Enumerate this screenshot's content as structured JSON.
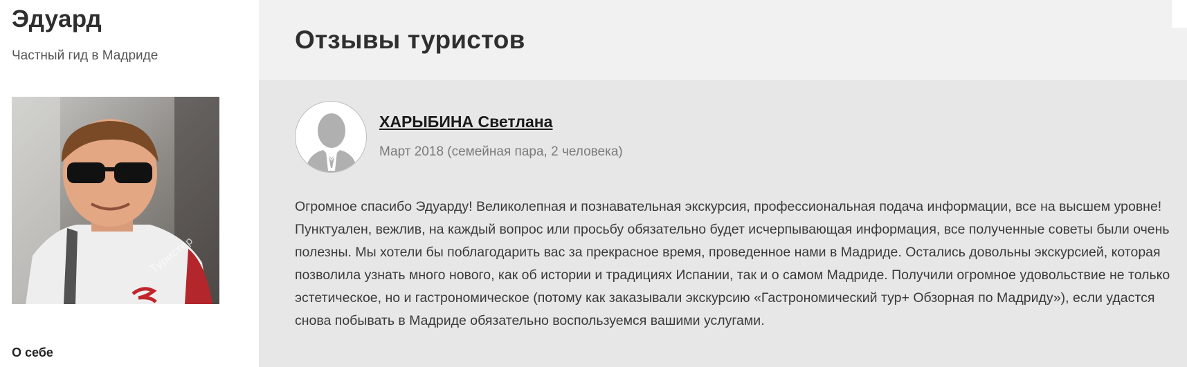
{
  "guide": {
    "name": "Эдуард",
    "subtitle": "Частный гид в Мадриде",
    "photo_watermark": "Туристер",
    "about_heading": "О себе"
  },
  "reviews_section": {
    "title": "Отзывы туристов"
  },
  "reviews": [
    {
      "author": "ХАРЫБИНА Светлана",
      "meta": "Март 2018 (семейная пара, 2 человека)",
      "text": "Огромное спасибо Эдуарду! Великолепная и познавательная экскурсия, профессиональная подача информации, все на высшем уровне! Пунктуален, вежлив, на каждый вопрос или просьбу обязательно будет исчерпывающая информация, все полученные советы были очень полезны. Мы хотели бы поблагодарить вас за прекрасное время, проведенное нами в Мадриде. Остались довольны экскурсией, которая позволила узнать много нового, как об истории и традициях Испании, так и о самом Мадриде. Получили огромное удовольствие не только эстетическое, но и гастрономическое (потому как заказывали экскурсию «Гастрономический тур+ Обзорная по Мадриду»), если удастся снова побывать в Мадриде обязательно воспользуемся вашими услугами."
    }
  ],
  "colors": {
    "main_background": "#e7e7e7",
    "header_background": "#f1f1f1",
    "avatar_silhouette": "#b0b0b0"
  },
  "icons": {
    "avatar_placeholder": "user-silhouette-icon"
  }
}
